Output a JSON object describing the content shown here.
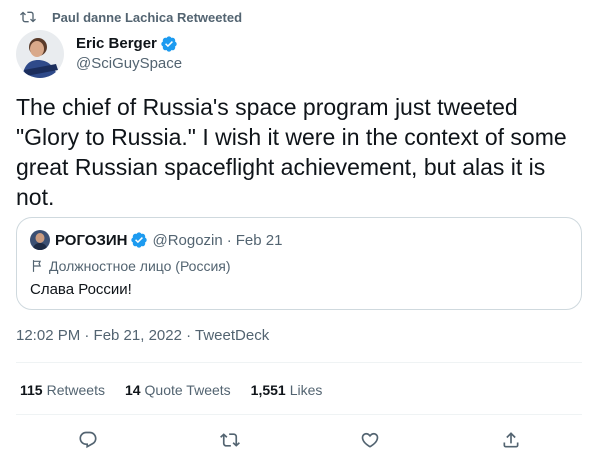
{
  "retweet": {
    "text": "Paul danne Lachica Retweeted",
    "icon": "retweet-icon"
  },
  "author": {
    "name": "Eric Berger",
    "handle": "@SciGuySpace",
    "verified": true,
    "verified_color": "#1d9bf0"
  },
  "tweet": {
    "text": "The chief of Russia's space program just tweeted \"Glory to Russia.\" I wish it were in the context of some great Russian spaceflight achievement, but alas it is not."
  },
  "quoted": {
    "name": "РОГОЗИН",
    "verified": true,
    "handle": "@Rogozin",
    "separator": "·",
    "date": "Feb 21",
    "label_icon": "flag-icon",
    "label": "Должностное лицо (Россия)",
    "text": "Слава России!"
  },
  "meta": {
    "text": "12:02 PM · Feb 21, 2022 · TweetDeck"
  },
  "stats": [
    {
      "count": "115",
      "label": "Retweets"
    },
    {
      "count": "14",
      "label": "Quote Tweets"
    },
    {
      "count": "1,551",
      "label": "Likes"
    }
  ],
  "actions": [
    "reply-icon",
    "retweet-icon",
    "like-icon",
    "share-icon"
  ],
  "colors": {
    "text": "#0f1419",
    "secondary": "#536471",
    "border": "#cfd9de",
    "accent": "#1d9bf0"
  }
}
